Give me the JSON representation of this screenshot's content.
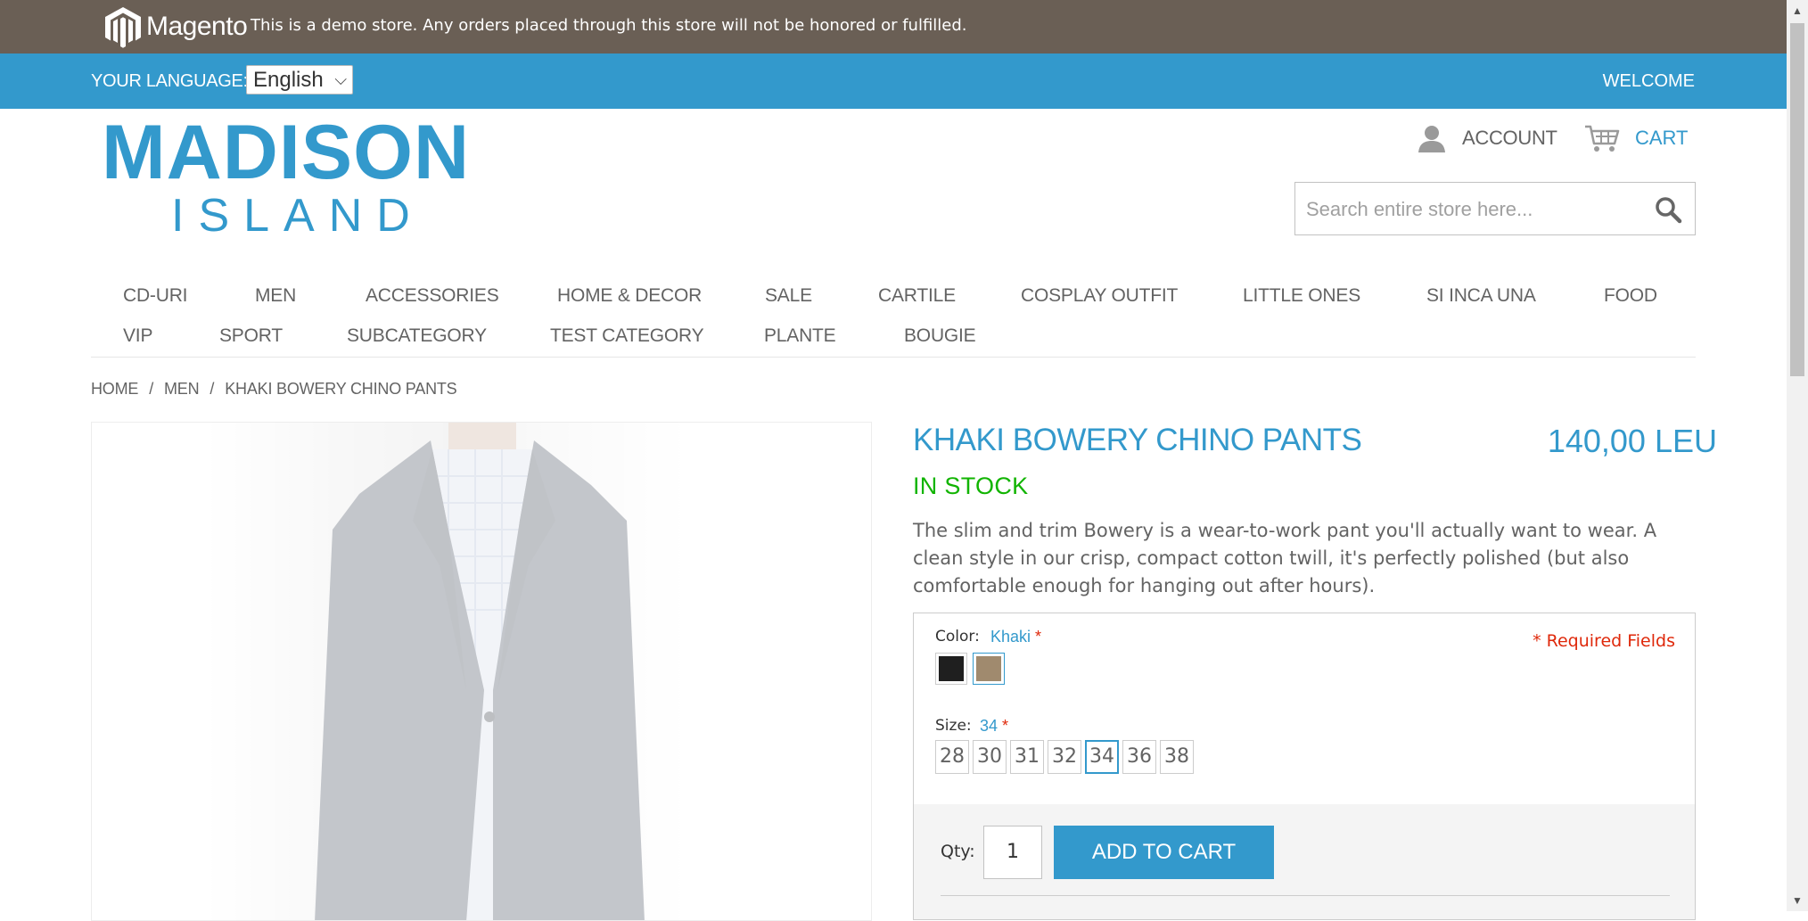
{
  "demo_notice": {
    "brand": "Magento",
    "text": "This is a demo store. Any orders placed through this store will not be honored or fulfilled."
  },
  "language_bar": {
    "label": "YOUR LANGUAGE:",
    "selected_language": "English",
    "welcome": "WELCOME"
  },
  "header": {
    "logo_top": "MADISON",
    "logo_bottom": "ISLAND",
    "account_label": "ACCOUNT",
    "cart_label": "CART",
    "search_placeholder": "Search entire store here..."
  },
  "nav": {
    "items": [
      "CD-URI",
      "MEN",
      "ACCESSORIES",
      "HOME & DECOR",
      "SALE",
      "CARTILE",
      "COSPLAY OUTFIT",
      "LITTLE ONES",
      "SI INCA UNA",
      "FOOD",
      "VIP",
      "SPORT",
      "SUBCATEGORY",
      "TEST CATEGORY",
      "PLANTE",
      "BOUGIE"
    ]
  },
  "breadcrumb": {
    "items": [
      "HOME",
      "MEN",
      "KHAKI BOWERY CHINO PANTS"
    ],
    "separator": "/"
  },
  "product": {
    "name": "KHAKI BOWERY CHINO PANTS",
    "price": "140,00 LEU",
    "stock": "IN STOCK",
    "description": "The slim and trim Bowery is a wear-to-work pant you'll actually want to wear. A clean style in our crisp, compact cotton twill, it's perfectly polished (but also comfortable enough for hanging out after hours).",
    "required_fields": "* Required Fields",
    "color": {
      "label": "Color:",
      "selected": "Khaki",
      "required_mark": "*",
      "swatches": [
        {
          "name": "Black",
          "hex": "#1f1f1f"
        },
        {
          "name": "Khaki",
          "hex": "#a08a6e"
        }
      ]
    },
    "size": {
      "label": "Size:",
      "selected": "34",
      "required_mark": "*",
      "options": [
        "28",
        "30",
        "31",
        "32",
        "34",
        "36",
        "38"
      ]
    },
    "qty_label": "Qty:",
    "qty_value": "1",
    "add_to_cart": "ADD TO CART"
  },
  "colors": {
    "brand_blue": "#3399cc",
    "demo_bar": "#6a5f55",
    "in_stock_green": "#11b400",
    "required_red": "#df280a"
  }
}
